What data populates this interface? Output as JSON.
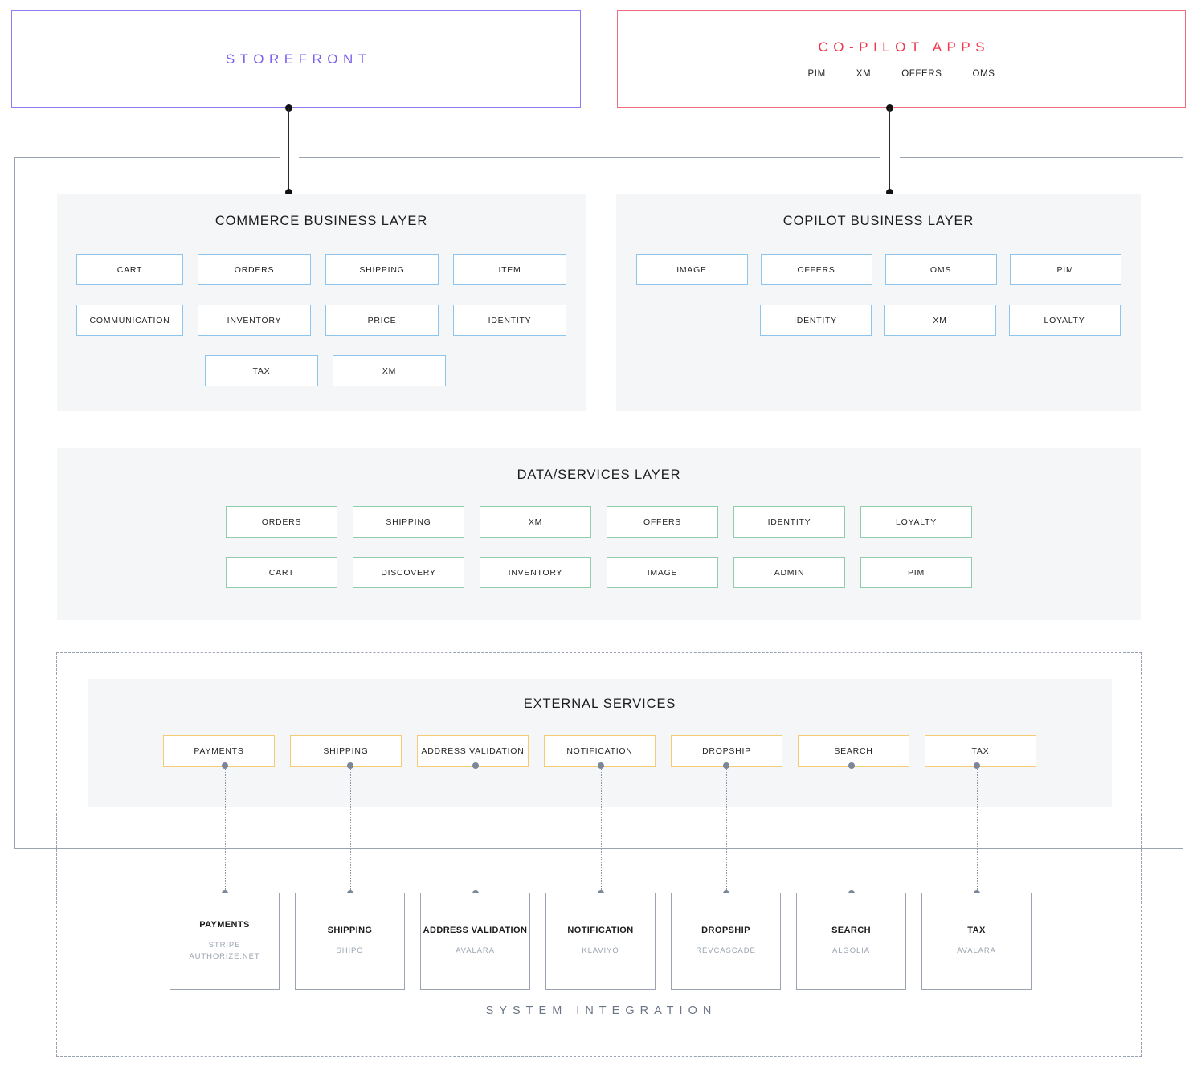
{
  "top": {
    "storefront": {
      "title": "STOREFRONT",
      "color": "#7c5ff0"
    },
    "copilot": {
      "title": "CO-PILOT APPS",
      "color": "#f0384f",
      "apps": [
        "PIM",
        "XM",
        "OFFERS",
        "OMS"
      ]
    }
  },
  "layers": {
    "commerce": {
      "title": "COMMERCE BUSINESS LAYER",
      "accent": "#8ec5ef",
      "rows": [
        [
          "CART",
          "ORDERS",
          "SHIPPING",
          "ITEM"
        ],
        [
          "COMMUNICATION",
          "INVENTORY",
          "PRICE",
          "IDENTITY"
        ],
        [
          "TAX",
          "XM"
        ]
      ]
    },
    "copilot": {
      "title": "COPILOT BUSINESS LAYER",
      "accent": "#8ec5ef",
      "rows": [
        [
          "IMAGE",
          "OFFERS",
          "OMS",
          "PIM"
        ],
        [
          "IDENTITY",
          "XM",
          "LOYALTY"
        ]
      ]
    },
    "data": {
      "title": "DATA/SERVICES LAYER",
      "accent": "#93ccab",
      "rows": [
        [
          "ORDERS",
          "SHIPPING",
          "XM",
          "OFFERS",
          "IDENTITY",
          "LOYALTY"
        ],
        [
          "CART",
          "DISCOVERY",
          "INVENTORY",
          "IMAGE",
          "ADMIN",
          "PIM"
        ]
      ]
    },
    "external": {
      "title": "EXTERNAL SERVICES",
      "accent": "#f2cb73",
      "items": [
        "PAYMENTS",
        "SHIPPING",
        "ADDRESS VALIDATION",
        "NOTIFICATION",
        "DROPSHIP",
        "SEARCH",
        "TAX"
      ]
    }
  },
  "system_integration": {
    "label": "SYSTEM INTEGRATION",
    "vendors": [
      {
        "title": "PAYMENTS",
        "providers": "STRIPE\nAUTHORIZE.NET"
      },
      {
        "title": "SHIPPING",
        "providers": "SHIPO"
      },
      {
        "title": "ADDRESS VALIDATION",
        "providers": "AVALARA"
      },
      {
        "title": "NOTIFICATION",
        "providers": "KLAVIYO"
      },
      {
        "title": "DROPSHIP",
        "providers": "REVCASCADE"
      },
      {
        "title": "SEARCH",
        "providers": "ALGOLIA"
      },
      {
        "title": "TAX",
        "providers": "AVALARA"
      }
    ]
  }
}
